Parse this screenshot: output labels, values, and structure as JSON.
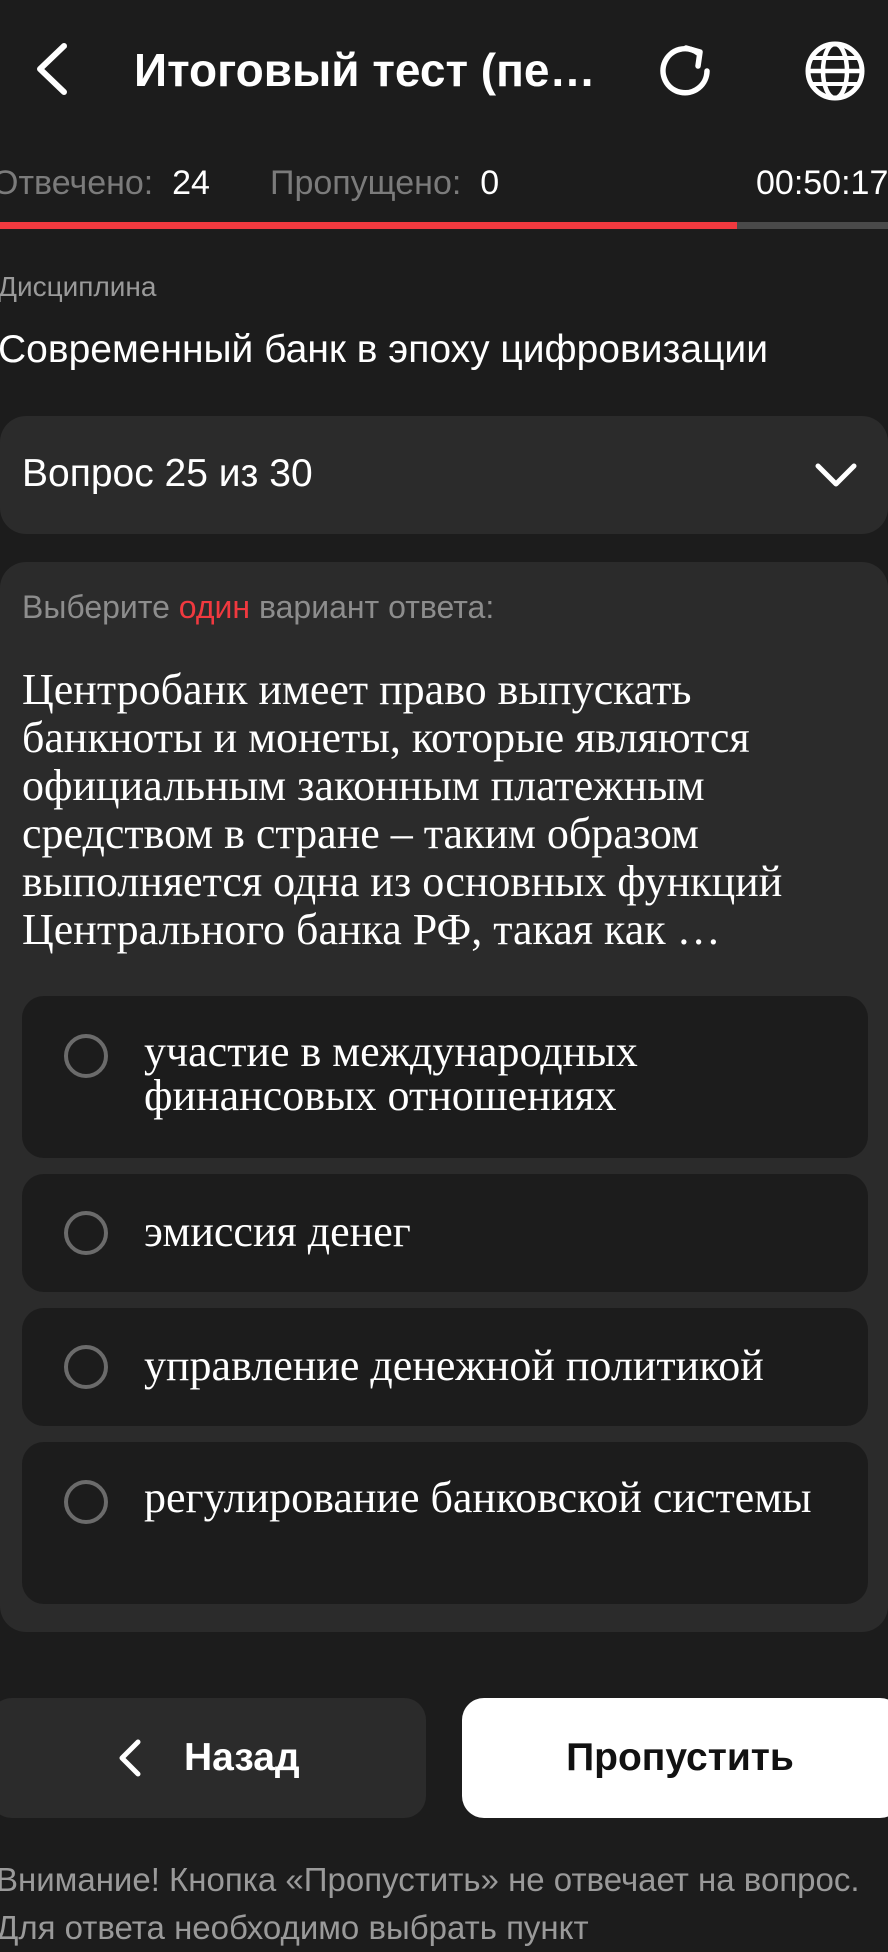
{
  "header": {
    "title": "Итоговый тест (пе…",
    "icons": {
      "back": "chevron-left-icon",
      "refresh": "refresh-icon",
      "language": "globe-icon"
    }
  },
  "stats": {
    "answered_label": "Отвечено:",
    "answered_value": "24",
    "skipped_label": "Пропущено:",
    "skipped_value": "0",
    "timer": "00:50:17",
    "progress": 0.83
  },
  "discipline": {
    "label": "Дисциплина",
    "name": "Современный банк в эпоху цифровизации"
  },
  "question_selector": {
    "label": "Вопрос 25 из 30"
  },
  "question": {
    "instruction_prefix": "Выберите",
    "instruction_highlight": "один",
    "instruction_suffix": "вариант ответа:",
    "text": "Центробанк имеет право выпускать банкноты и монеты, которые являются официальным законным платежным средством в стране – таким образом выполняется одна из основных функций Центрального банка РФ, такая как …",
    "options": [
      {
        "text": "участие в международных финансовых отношениях"
      },
      {
        "text": "эмиссия денег"
      },
      {
        "text": "управление денежной политикой"
      },
      {
        "text": "регулирование банковской системы"
      }
    ]
  },
  "buttons": {
    "back_label": "Назад",
    "skip_label": "Пропустить"
  },
  "notice": "Внимание! Кнопка «Пропустить» не отвечает на вопрос. Для ответа необходимо выбрать пункт",
  "colors": {
    "background": "#1c1c1c",
    "card": "#2b2b2b",
    "accent": "#f0393f",
    "muted": "#7b7b7b"
  }
}
